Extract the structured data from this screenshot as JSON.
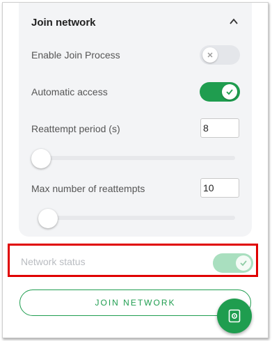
{
  "section": {
    "title": "Join network",
    "enable_join": {
      "label": "Enable Join Process",
      "on": false
    },
    "automatic_access": {
      "label": "Automatic access",
      "on": true
    },
    "reattempt_period": {
      "label": "Reattempt period (s)",
      "value": "8",
      "slider_fraction": 0.0
    },
    "max_reattempts": {
      "label": "Max number of reattempts",
      "value": "10",
      "slider_fraction": 0.0
    }
  },
  "network_status": {
    "label": "Network status",
    "on": true,
    "disabled": true
  },
  "join_button": {
    "label": "JOIN NETWORK"
  },
  "colors": {
    "accent": "#1f9d4f",
    "highlight_border": "#e00000"
  },
  "icons": {
    "collapse": "chevron-up-icon",
    "fab": "device-icon"
  }
}
